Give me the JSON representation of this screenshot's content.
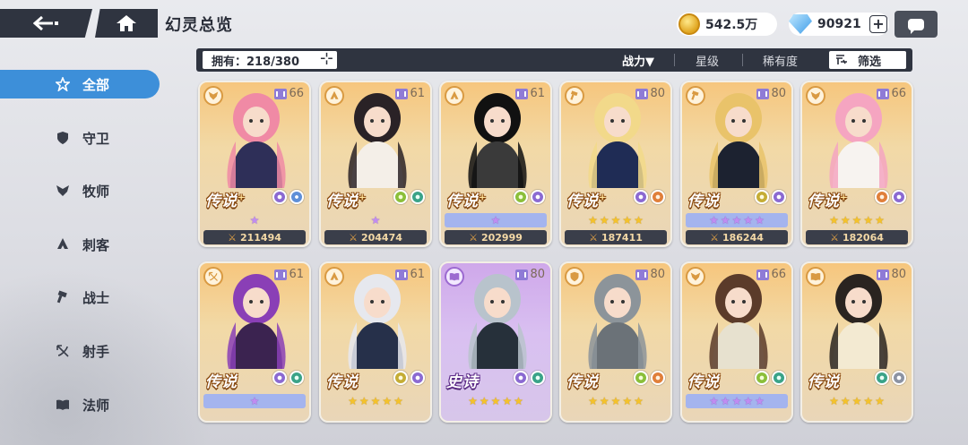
{
  "header": {
    "title": "幻灵总览",
    "back_icon": "back-arrow-icon",
    "home_icon": "home-icon",
    "gold_amount": "542.5万",
    "gem_amount": "90921",
    "plus_symbol": "+"
  },
  "filterbar": {
    "owned": "拥有：218/380",
    "sort_options": [
      "战力▼",
      "星级",
      "稀有度"
    ],
    "filter_label": "筛选"
  },
  "sidebar": {
    "items": [
      {
        "label": "全部",
        "icon": "all-star-icon",
        "active": true
      },
      {
        "label": "守卫",
        "icon": "shield-icon",
        "active": false
      },
      {
        "label": "牧师",
        "icon": "wings-icon",
        "active": false
      },
      {
        "label": "刺客",
        "icon": "assassin-icon",
        "active": false
      },
      {
        "label": "战士",
        "icon": "hammer-icon",
        "active": false
      },
      {
        "label": "射手",
        "icon": "bow-icon",
        "active": false
      },
      {
        "label": "法师",
        "icon": "book-icon",
        "active": false
      }
    ]
  },
  "cards": [
    {
      "level": "66",
      "rarity": "传说",
      "plus": "+",
      "stars": 1,
      "star_color": "purple",
      "bar": "plain",
      "power": "211494",
      "tone": "gold",
      "hair": "#f08aa5",
      "outfit": "#2e2f58",
      "badges": [
        "b-purple",
        "b-blue"
      ],
      "role": "wings-icon"
    },
    {
      "level": "61",
      "rarity": "传说",
      "plus": "+",
      "stars": 1,
      "star_color": "purple",
      "bar": "plain",
      "power": "204474",
      "tone": "gold",
      "hair": "#2a2226",
      "outfit": "#f4efe8",
      "badges": [
        "b-green",
        "b-teal"
      ],
      "role": "assassin-icon"
    },
    {
      "level": "61",
      "rarity": "传说",
      "plus": "+",
      "stars": 1,
      "star_color": "purple",
      "bar": "blue",
      "power": "202999",
      "tone": "gold",
      "hair": "#111111",
      "outfit": "#3a3a3a",
      "badges": [
        "b-green",
        "b-purple"
      ],
      "role": "assassin-icon"
    },
    {
      "level": "80",
      "rarity": "传说",
      "plus": "+",
      "stars": 5,
      "star_color": "gold",
      "bar": "plain",
      "power": "187411",
      "tone": "gold",
      "hair": "#f2d98a",
      "outfit": "#1f2c55",
      "badges": [
        "b-purple",
        "b-orange"
      ],
      "role": "hammer-icon"
    },
    {
      "level": "80",
      "rarity": "传说",
      "plus": "",
      "stars": 5,
      "star_color": "purple",
      "bar": "blue",
      "power": "186244",
      "tone": "gold",
      "hair": "#e9c36a",
      "outfit": "#1c2230",
      "badges": [
        "b-olive",
        "b-purple"
      ],
      "role": "hammer-icon"
    },
    {
      "level": "66",
      "rarity": "传说",
      "plus": "+",
      "stars": 5,
      "star_color": "gold",
      "bar": "plain",
      "power": "182064",
      "tone": "gold",
      "hair": "#f5a5c1",
      "outfit": "#f7f3f0",
      "badges": [
        "b-orange",
        "b-purple"
      ],
      "role": "wings-icon"
    },
    {
      "level": "61",
      "rarity": "传说",
      "plus": "",
      "stars": 1,
      "star_color": "purple",
      "bar": "blue",
      "power": "",
      "tone": "gold",
      "hair": "#8a3fb6",
      "outfit": "#3b2350",
      "badges": [
        "b-purple",
        "b-teal"
      ],
      "role": "bow-icon"
    },
    {
      "level": "61",
      "rarity": "传说",
      "plus": "",
      "stars": 5,
      "star_color": "gold",
      "bar": "plain",
      "power": "",
      "tone": "gold",
      "hair": "#e6e8ee",
      "outfit": "#26304a",
      "badges": [
        "b-olive",
        "b-purple"
      ],
      "role": "assassin-icon"
    },
    {
      "level": "80",
      "rarity": "史诗",
      "plus": "",
      "stars": 5,
      "star_color": "gold",
      "bar": "plain",
      "power": "",
      "tone": "epic",
      "hair": "#b8c3cc",
      "outfit": "#26303a",
      "badges": [
        "b-purple",
        "b-teal"
      ],
      "role": "book-icon"
    },
    {
      "level": "80",
      "rarity": "传说",
      "plus": "",
      "stars": 5,
      "star_color": "gold",
      "bar": "plain",
      "power": "",
      "tone": "gold",
      "hair": "#8c949a",
      "outfit": "#6b7278",
      "badges": [
        "b-green",
        "b-orange"
      ],
      "role": "shield-icon"
    },
    {
      "level": "66",
      "rarity": "传说",
      "plus": "",
      "stars": 5,
      "star_color": "purple",
      "bar": "blue",
      "power": "",
      "tone": "gold",
      "hair": "#5b3b2a",
      "outfit": "#e7e1cf",
      "badges": [
        "b-green",
        "b-teal"
      ],
      "role": "wings-icon"
    },
    {
      "level": "80",
      "rarity": "传说",
      "plus": "",
      "stars": 5,
      "star_color": "gold",
      "bar": "plain",
      "power": "",
      "tone": "gold",
      "hair": "#2a2420",
      "outfit": "#f3ead2",
      "badges": [
        "b-teal",
        "b-grey"
      ],
      "role": "book-icon"
    }
  ]
}
